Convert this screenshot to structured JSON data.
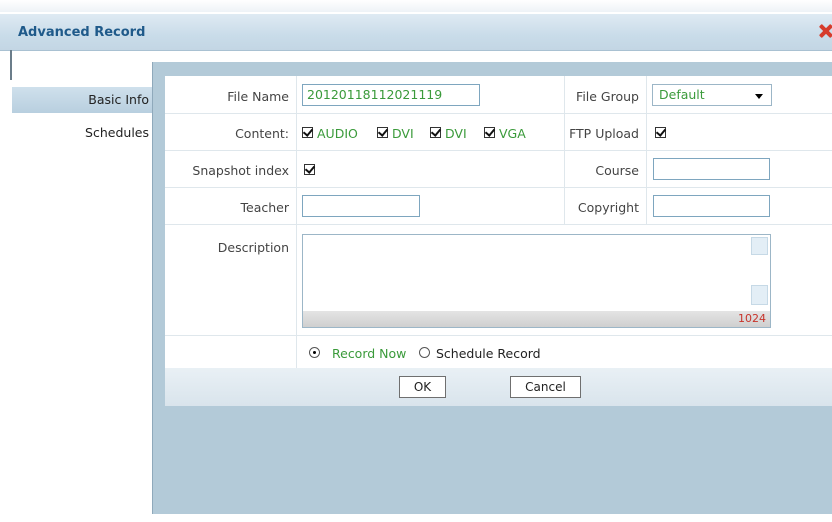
{
  "window": {
    "title": "Advanced Record"
  },
  "sidebar": {
    "items": [
      {
        "label": "Basic Info",
        "active": true
      },
      {
        "label": "Schedules",
        "active": false
      }
    ]
  },
  "form": {
    "file_name": {
      "label": "File Name",
      "value": "20120118112021119"
    },
    "file_group": {
      "label": "File Group",
      "selected": "Default"
    },
    "content": {
      "label": "Content:",
      "options": [
        {
          "label": "AUDIO",
          "checked": true
        },
        {
          "label": "DVI",
          "checked": true
        },
        {
          "label": "DVI",
          "checked": true
        },
        {
          "label": "VGA",
          "checked": true
        }
      ]
    },
    "ftp_upload": {
      "label": "FTP Upload",
      "checked": true
    },
    "snapshot_index": {
      "label": "Snapshot index",
      "checked": true
    },
    "course": {
      "label": "Course",
      "value": ""
    },
    "teacher": {
      "label": "Teacher",
      "value": ""
    },
    "copyright": {
      "label": "Copyright",
      "value": ""
    },
    "description": {
      "label": "Description",
      "value": "",
      "remaining": "1024"
    },
    "record_mode": {
      "options": [
        {
          "label": "Record Now",
          "selected": true
        },
        {
          "label": "Schedule Record",
          "selected": false
        }
      ]
    }
  },
  "buttons": {
    "ok": "OK",
    "cancel": "Cancel"
  },
  "colors": {
    "accent_text": "#3a9a3a",
    "title": "#1f5a8a",
    "close": "#d63c2c",
    "panel": "#b3cad8"
  }
}
